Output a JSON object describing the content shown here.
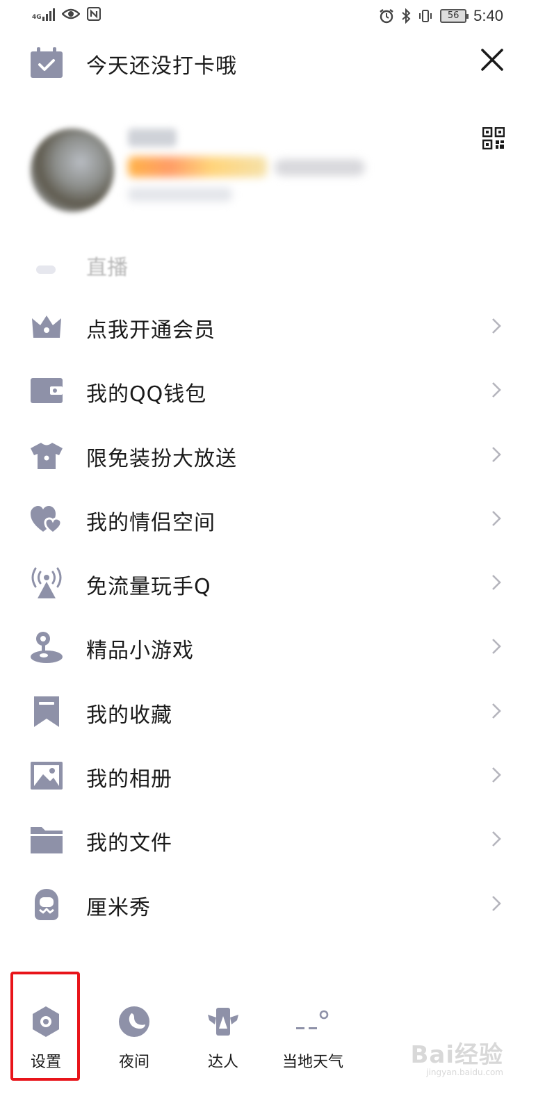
{
  "status_bar": {
    "network": "4G",
    "time": "5:40",
    "battery": "56"
  },
  "top_bar": {
    "checkin_text": "今天还没打卡哦"
  },
  "menu": {
    "live_peek": "直播",
    "items": [
      {
        "label": "点我开通会员",
        "icon": "crown-icon"
      },
      {
        "label": "我的QQ钱包",
        "icon": "wallet-icon"
      },
      {
        "label": "限免装扮大放送",
        "icon": "shirt-icon"
      },
      {
        "label": "我的情侣空间",
        "icon": "hearts-icon"
      },
      {
        "label": "免流量玩手Q",
        "icon": "broadcast-icon"
      },
      {
        "label": "精品小游戏",
        "icon": "joystick-icon"
      },
      {
        "label": "我的收藏",
        "icon": "bookmark-icon"
      },
      {
        "label": "我的相册",
        "icon": "image-icon"
      },
      {
        "label": "我的文件",
        "icon": "folder-icon"
      },
      {
        "label": "厘米秀",
        "icon": "avatar-face-icon"
      }
    ]
  },
  "bottom_bar": {
    "settings": "设置",
    "night": "夜间",
    "expert": "达人",
    "weather": "当地天气"
  },
  "watermark": {
    "brand": "Bai经验",
    "url": "jingyan.baidu.com"
  },
  "colors": {
    "icon_gray": "#8e91a8",
    "highlight": "#e8141a"
  }
}
